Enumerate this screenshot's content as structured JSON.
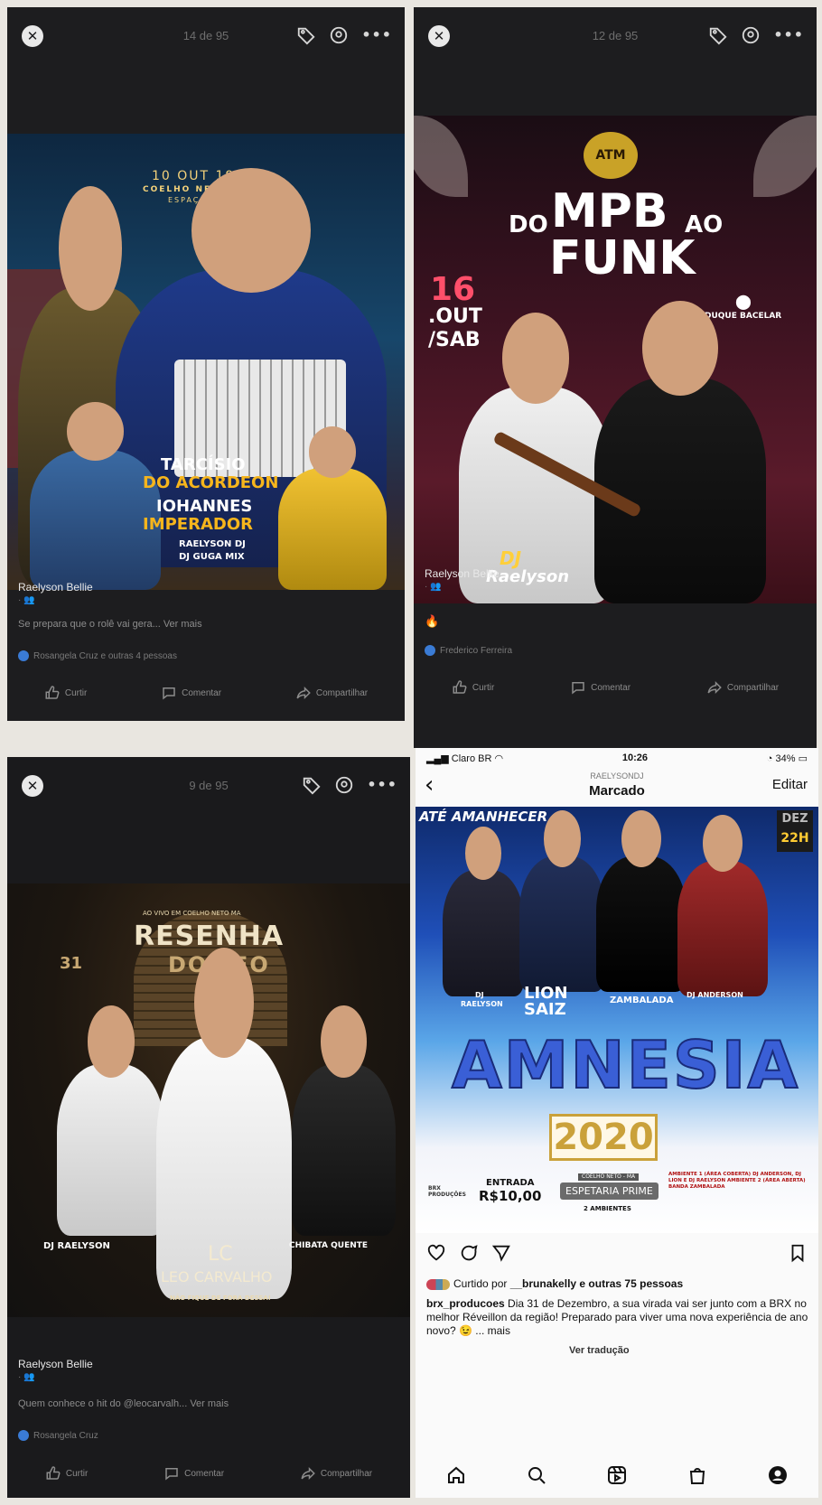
{
  "posts": [
    {
      "counter": "14 de 95",
      "poster": {
        "date_line": "10 OUT 19H",
        "venue": "COELHO NETO MA",
        "venue_sub": "ESPAÇO MM",
        "artist1a": "TARCÍSIO",
        "artist1b": "DO ACORDEON",
        "artist2a": "IOHANNES",
        "artist2b": "IMPERADOR",
        "artist3": "RAELYSON DJ",
        "artist4": "DJ GUGA MIX"
      },
      "author": "Raelyson Bellie",
      "caption": "Se prepara que o rolê vai gera... Ver mais",
      "likes": "Rosangela Cruz e outras 4 pessoas",
      "actions": [
        "Curtir",
        "Comentar",
        "Compartilhar"
      ]
    },
    {
      "counter": "12 de 95",
      "poster": {
        "logo": "ATM",
        "title_do": "DO",
        "title_mpb": "MPB",
        "title_ao": "AO",
        "title_funk": "FUNK",
        "day": "16",
        "month": ".OUT",
        "weekday": "/SAB",
        "place": "DUQUE BACELAR",
        "dj_label": "DJ",
        "dj_name": "Raelyson"
      },
      "author": "Raelyson Bellie",
      "emoji": "🔥",
      "likes": "Frederico Ferreira",
      "actions": [
        "Curtir",
        "Comentar",
        "Compartilhar"
      ]
    },
    {
      "counter": "9 de 95",
      "poster": {
        "top_line": "AO VIVO EM COELHO NETO MA",
        "title1": "RESENHA",
        "title2": "DO LEO",
        "side_date": "31",
        "logo": "LC",
        "headliner": "LEO CARVALHO",
        "dj": "DJ RAELYSON",
        "guest": "CHIBATA QUENTE",
        "tagline": "NÃO FIQUE DE FORA DESSA!"
      },
      "author": "Raelyson Bellie",
      "caption": "Quem conhece o hit do @leocarvalh... Ver mais",
      "likes": "Rosangela Cruz",
      "actions": [
        "Curtir",
        "Comentar",
        "Compartilhar"
      ]
    }
  ],
  "instagram": {
    "carrier": "Claro BR",
    "time": "10:26",
    "battery": "34%",
    "username": "RAELYSONDJ",
    "title": "Marcado",
    "edit": "Editar",
    "poster": {
      "banner": "ATÉ AMANHECER",
      "date_box": "DEZ",
      "time": "22H",
      "dj1_a": "DJ",
      "dj1_b": "RAELYSON",
      "dj2": "LION SAIZ",
      "dj3": "ZAMBALADA",
      "dj4": "DJ ANDERSON",
      "title": "AMNESIA",
      "year": "2020",
      "entry_label": "ENTRADA",
      "entry_price": "R$10,00",
      "venue_top": "COELHO NETO - MA",
      "venue": "ESPETARIA PRIME",
      "ambients": "2 AMBIENTES",
      "ambients_detail": "AMBIENTE 1 (ÁREA COBERTA) DJ ANDERSON, DJ LION E DJ RAELYSON AMBIENTE 2 (ÁREA ABERTA) BANDA ZAMBALADA",
      "producer": "BRX PRODUÇÕES"
    },
    "liked_by_prefix": "Curtido por ",
    "liked_by_user": "__brunakelly",
    "liked_by_suffix": " e outras 75 pessoas",
    "caption_user": "brx_producoes",
    "caption": " Dia 31 de Dezembro, a sua virada vai ser junto com a BRX no melhor Réveillon da região! Preparado para viver uma nova experiência de ano novo? 😉 ... mais",
    "translate": "Ver tradução"
  }
}
